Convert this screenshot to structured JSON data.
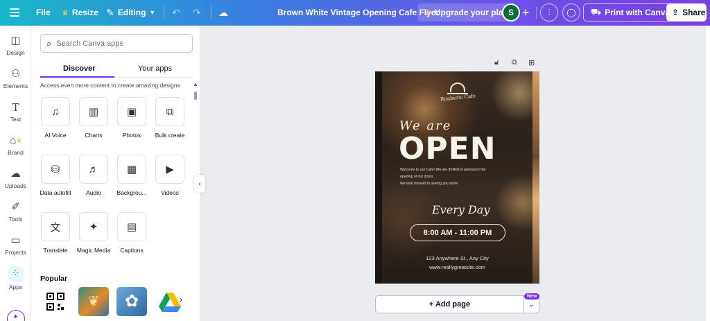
{
  "topbar": {
    "file": "File",
    "resize": "Resize",
    "editing": "Editing",
    "title": "Brown White Vintage Opening Cafe Flyer",
    "upgrade": "Upgrade your plan",
    "avatar_initial": "S",
    "print": "Print with Canva",
    "share": "Share"
  },
  "rail": {
    "items": [
      {
        "label": "Design",
        "icon": "layout-icon"
      },
      {
        "label": "Elements",
        "icon": "shapes-icon"
      },
      {
        "label": "Text",
        "icon": "text-icon"
      },
      {
        "label": "Brand",
        "icon": "brand-icon"
      },
      {
        "label": "Uploads",
        "icon": "upload-icon"
      },
      {
        "label": "Tools",
        "icon": "tools-icon"
      },
      {
        "label": "Projects",
        "icon": "folder-icon"
      },
      {
        "label": "Apps",
        "icon": "apps-icon"
      }
    ]
  },
  "panel": {
    "search_placeholder": "Search Canva apps",
    "tabs": [
      "Discover",
      "Your apps"
    ],
    "hint": "Access even more content to create amazing designs",
    "apps": [
      {
        "label": "AI Voice",
        "glyph": "♫"
      },
      {
        "label": "Charts",
        "glyph": "▥"
      },
      {
        "label": "Photos",
        "glyph": "▣"
      },
      {
        "label": "Bulk create",
        "glyph": "⧉"
      },
      {
        "label": "Data autofill",
        "glyph": "⛁"
      },
      {
        "label": "Audio",
        "glyph": "♬"
      },
      {
        "label": "Backgrou...",
        "glyph": "▩"
      },
      {
        "label": "Videos",
        "glyph": "▶"
      },
      {
        "label": "Translate",
        "glyph": "文"
      },
      {
        "label": "Magic Media",
        "glyph": "✦"
      },
      {
        "label": "Captions",
        "glyph": "▤"
      }
    ],
    "popular": "Popular"
  },
  "poster": {
    "brand": "Rimberio Cafe",
    "we_are": "We are",
    "open": "OPEN",
    "welcome_line1": "Welcome to our Cafe! We are thrilled to announce the",
    "welcome_line2": "opening of our doors.",
    "welcome_line3": "We look forward to seeing you soon!",
    "every_day": "Every Day",
    "hours": "8:00 AM - 11:00 PM",
    "address": "123 Anywhere St., Any City",
    "website": "www.reallygreatsite.com"
  },
  "canvas": {
    "add_page": "+ Add page",
    "new_badge": "New"
  },
  "colors": {
    "accent": "#7d2ae8",
    "teal": "#18b7c9"
  }
}
